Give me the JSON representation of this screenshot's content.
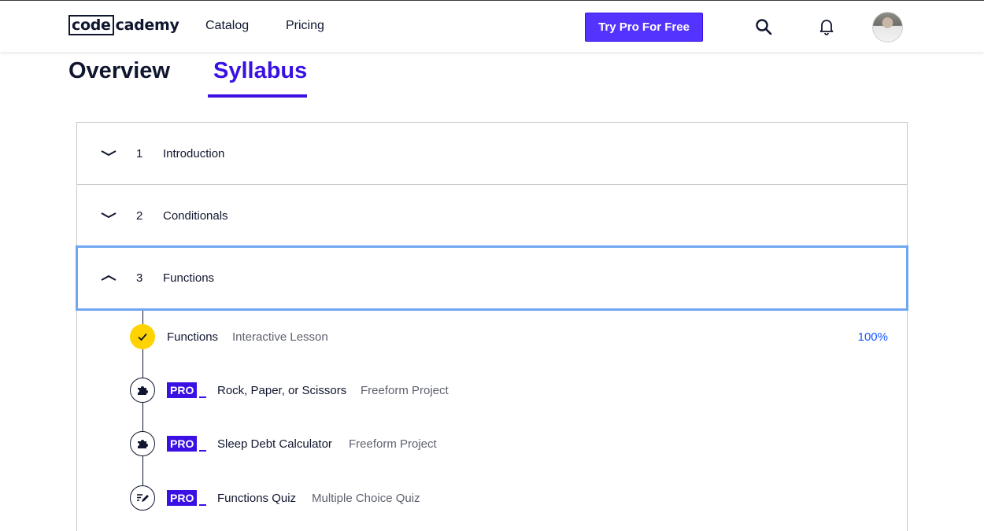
{
  "header": {
    "logo_left": "code",
    "logo_right": "cademy",
    "nav": {
      "catalog": "Catalog",
      "pricing": "Pricing"
    },
    "cta_label": "Try Pro For Free",
    "icons": {
      "search": "search-icon",
      "notifications": "bell-icon",
      "avatar": "user-avatar"
    }
  },
  "tabs": {
    "overview": "Overview",
    "syllabus": "Syllabus",
    "active": "Syllabus"
  },
  "modules": [
    {
      "number": "1",
      "title": "Introduction",
      "state": "collapsed"
    },
    {
      "number": "2",
      "title": "Conditionals",
      "state": "collapsed"
    },
    {
      "number": "3",
      "title": "Functions",
      "state": "expanded"
    }
  ],
  "module3_items": [
    {
      "title": "Functions",
      "type": "Interactive Lesson",
      "progress": "100%",
      "status": "complete",
      "icon": "check-icon"
    },
    {
      "badge": "PRO",
      "title": "Rock, Paper, or Scissors",
      "type": "Freeform Project",
      "status": "locked",
      "icon": "puzzle-icon"
    },
    {
      "badge": "PRO",
      "title": "Sleep Debt Calculator",
      "type": "Freeform Project",
      "status": "locked",
      "icon": "puzzle-icon"
    },
    {
      "badge": "PRO",
      "title": "Functions Quiz",
      "type": "Multiple Choice Quiz",
      "status": "locked",
      "icon": "quiz-pencil-icon"
    }
  ],
  "colors": {
    "brand": "#3a10e5",
    "cta": "#5533ff",
    "complete": "#ffd300",
    "focus_ring": "#6ea6f0",
    "progress_text": "#1557ff"
  }
}
